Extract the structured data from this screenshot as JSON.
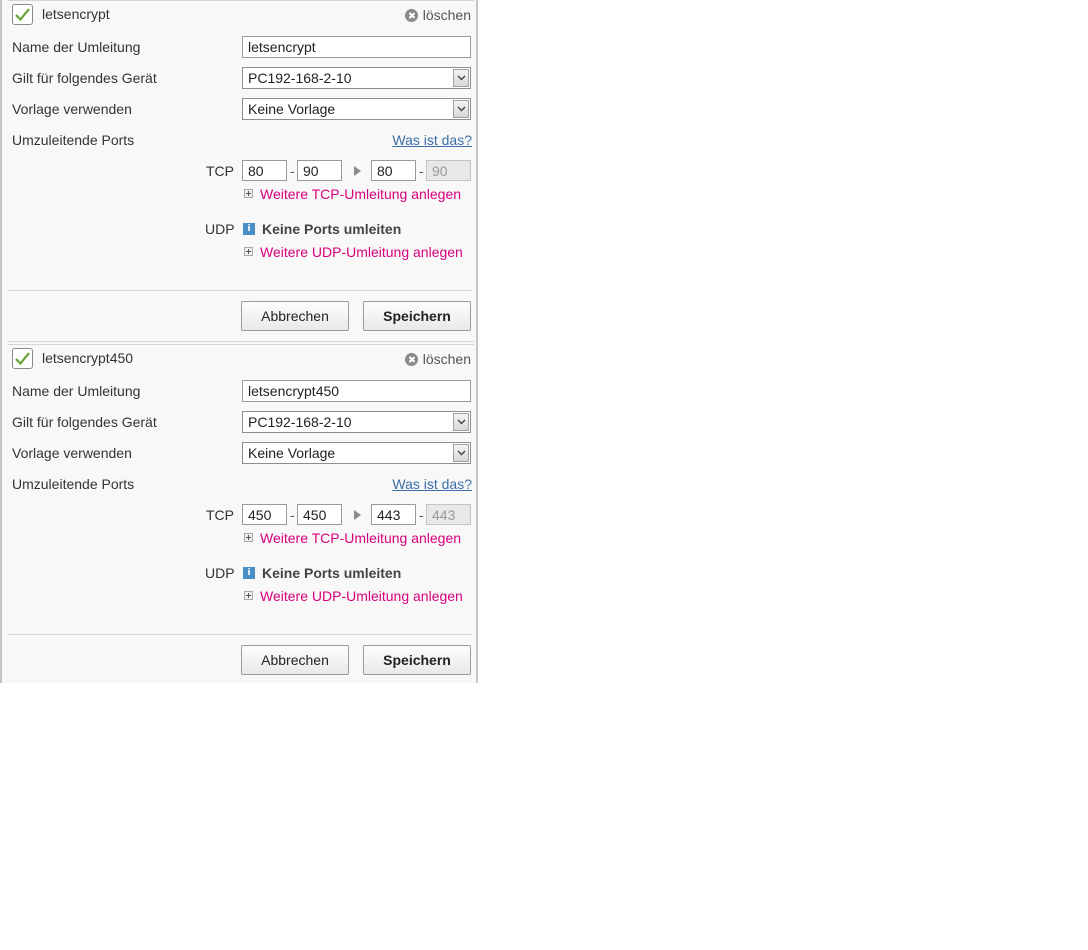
{
  "common": {
    "delete_label": "löschen",
    "labels": {
      "name": "Name der Umleitung",
      "device": "Gilt für folgendes Gerät",
      "template": "Vorlage verwenden",
      "ports": "Umzuleitende Ports"
    },
    "help_link": "Was ist das?",
    "tcp_label": "TCP",
    "udp_label": "UDP",
    "add_tcp": "Weitere TCP-Umleitung anlegen",
    "add_udp": "Weitere UDP-Umleitung anlegen",
    "no_ports": "Keine Ports umleiten",
    "dash": "-",
    "cancel_label": "Abbrechen",
    "save_label": "Speichern"
  },
  "rules": [
    {
      "enabled": true,
      "title": "letsencrypt",
      "name_value": "letsencrypt",
      "device": "PC192-168-2-10",
      "template": "Keine Vorlage",
      "tcp": {
        "from_start": "80",
        "from_end": "90",
        "to_start": "80",
        "to_end": "90"
      }
    },
    {
      "enabled": true,
      "title": "letsencrypt450",
      "name_value": "letsencrypt450",
      "device": "PC192-168-2-10",
      "template": "Keine Vorlage",
      "tcp": {
        "from_start": "450",
        "from_end": "450",
        "to_start": "443",
        "to_end": "443"
      }
    }
  ],
  "colors": {
    "check": "#6aa436",
    "link": "#3b6fa6",
    "accent_magenta": "#d9007e",
    "info": "#4a90c8"
  }
}
